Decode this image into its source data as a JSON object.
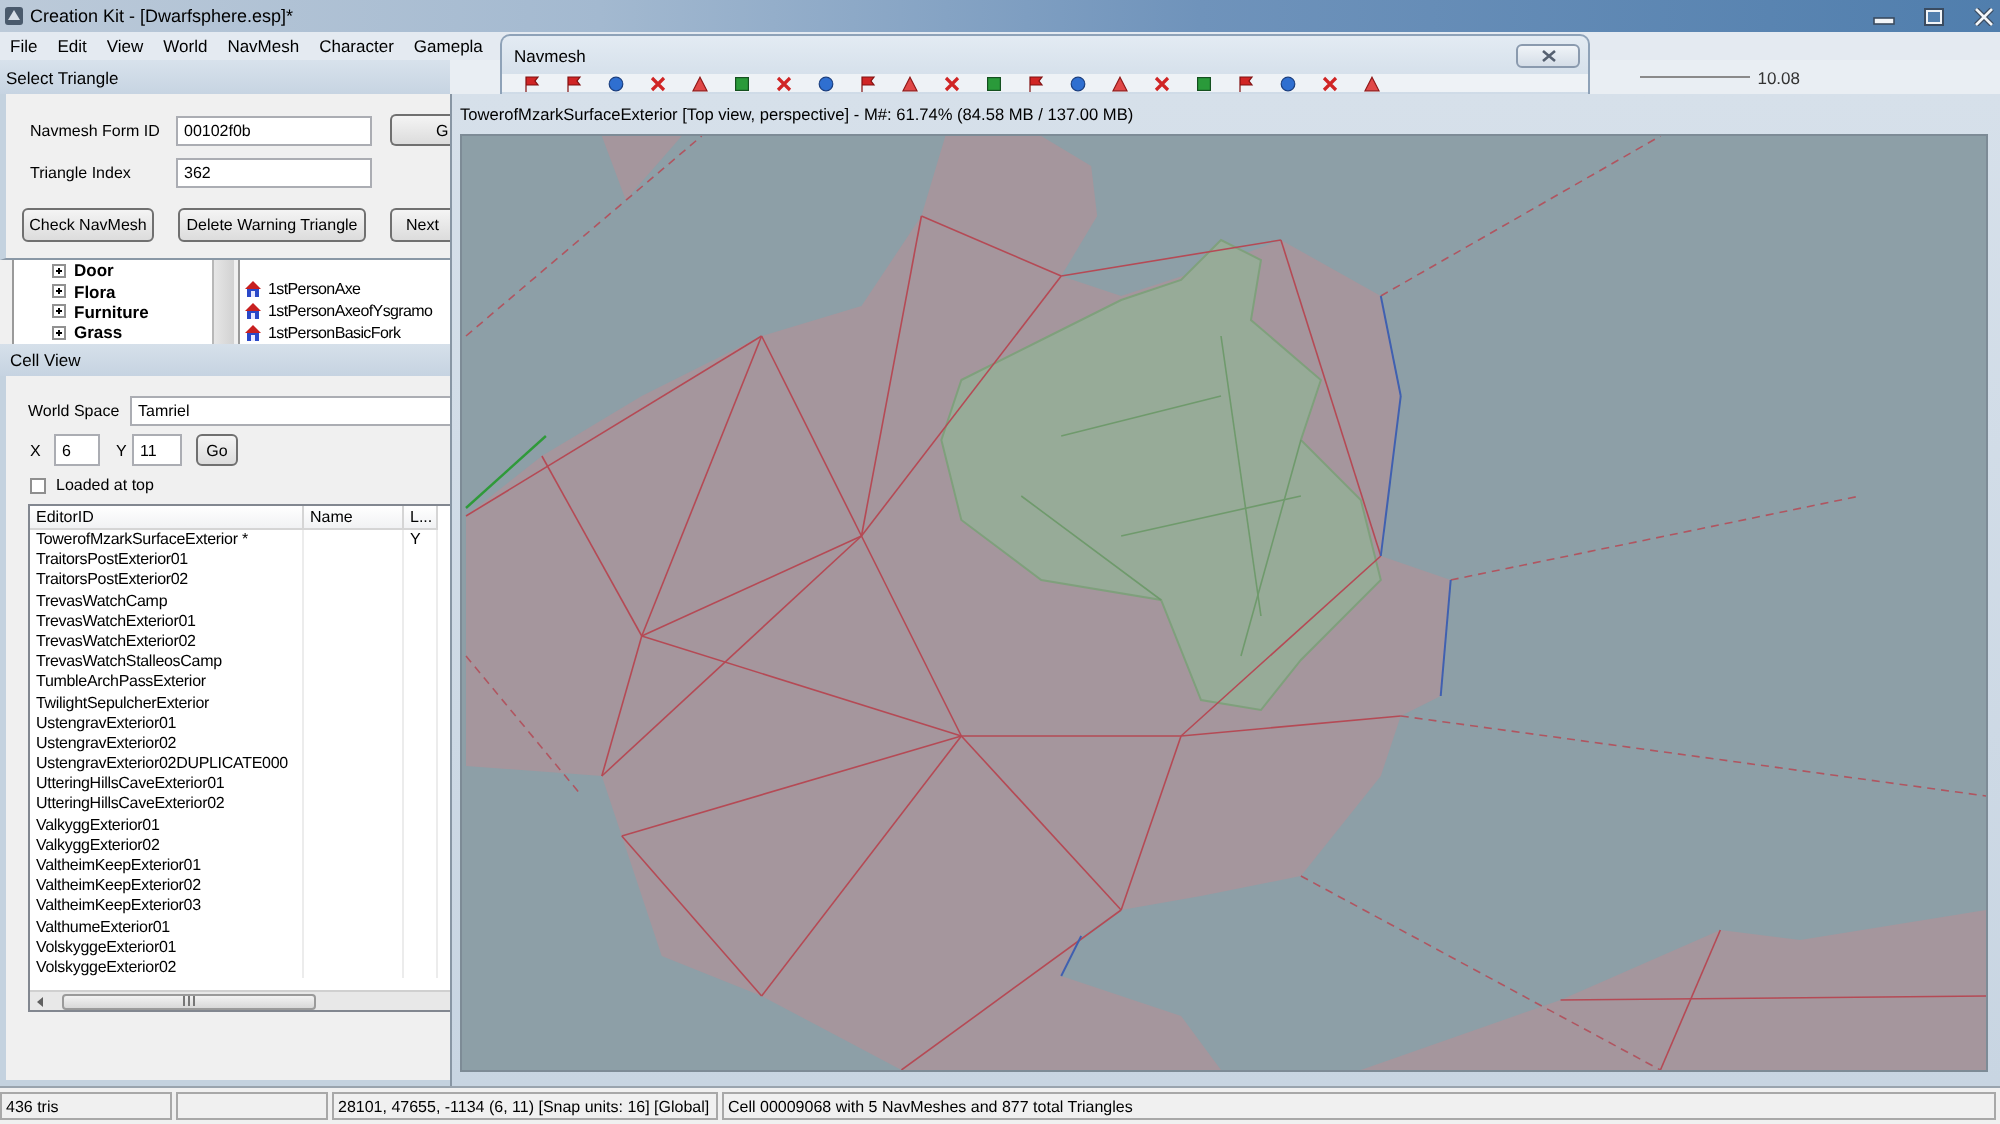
{
  "main_window": {
    "title": "Creation Kit - [Dwarfsphere.esp]*",
    "menu": [
      "File",
      "Edit",
      "View",
      "World",
      "NavMesh",
      "Character",
      "Gamepla"
    ],
    "toolbar_value": "10.08"
  },
  "navmesh_window": {
    "title": "Navmesh"
  },
  "select_triangle": {
    "title": "Select Triangle",
    "fields": [
      {
        "label": "Navmesh Form ID",
        "value": "00102f0b"
      },
      {
        "label": "Triangle Index",
        "value": "362"
      }
    ],
    "go_button": "G",
    "buttons": [
      "Check NavMesh",
      "Delete Warning Triangle",
      "Next"
    ]
  },
  "object_window": {
    "tree": [
      {
        "label": "Door",
        "expanded": false
      },
      {
        "label": "Flora",
        "expanded": false
      },
      {
        "label": "Furniture",
        "expanded": false
      },
      {
        "label": "Grass",
        "expanded": false
      }
    ],
    "items": [
      "1stPersonAxe",
      "1stPersonAxeofYsgramo",
      "1stPersonBasicFork"
    ]
  },
  "cell_view": {
    "title": "Cell View",
    "world_space": {
      "label": "World Space",
      "value": "Tamriel"
    },
    "x": {
      "label": "X",
      "value": "6"
    },
    "y": {
      "label": "Y",
      "value": "11"
    },
    "go_button": "Go",
    "loaded_at_top": {
      "label": "Loaded at top",
      "checked": false
    },
    "table": {
      "columns": [
        "EditorID",
        "Name",
        "L..."
      ],
      "rows": [
        {
          "editor_id": "TowerofMzarkSurfaceExterior *",
          "loaded": "Y"
        },
        {
          "editor_id": "TraitorsPostExterior01"
        },
        {
          "editor_id": "TraitorsPostExterior02"
        },
        {
          "editor_id": "TrevasWatchCamp"
        },
        {
          "editor_id": "TrevasWatchExterior01"
        },
        {
          "editor_id": "TrevasWatchExterior02"
        },
        {
          "editor_id": "TrevasWatchStalleosCamp"
        },
        {
          "editor_id": "TumbleArchPassExterior"
        },
        {
          "editor_id": "TwilightSepulcherExterior"
        },
        {
          "editor_id": "UstengravExterior01"
        },
        {
          "editor_id": "UstengravExterior02"
        },
        {
          "editor_id": "UstengravExterior02DUPLICATE000"
        },
        {
          "editor_id": "UtteringHillsCaveExterior01"
        },
        {
          "editor_id": "UtteringHillsCaveExterior02"
        },
        {
          "editor_id": "ValkyggExterior01"
        },
        {
          "editor_id": "ValkyggExterior02"
        },
        {
          "editor_id": "ValtheimKeepExterior01"
        },
        {
          "editor_id": "ValtheimKeepExterior02"
        },
        {
          "editor_id": "ValtheimKeepExterior03"
        },
        {
          "editor_id": "ValthumeExterior01"
        },
        {
          "editor_id": "VolskyggeExterior01"
        },
        {
          "editor_id": "VolskyggeExterior02"
        }
      ]
    }
  },
  "render_window": {
    "title": "TowerofMzarkSurfaceExterior [Top view, perspective] - M#: 61.74% (84.58 MB / 137.00 MB)"
  },
  "status_bar": {
    "triangles": "436 tris",
    "coordinates": "28101, 47655, -1134 (6, 11) [Snap units: 16] [Global]",
    "cell_info": "Cell 00009068 with 5 NavMeshes and 877 total Triangles"
  }
}
